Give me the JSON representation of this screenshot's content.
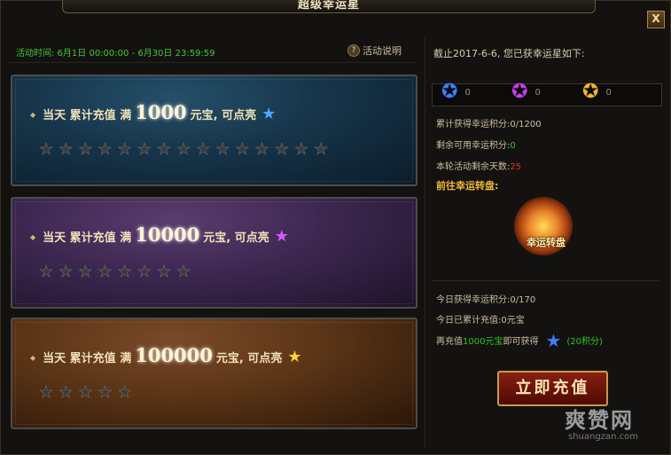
{
  "window": {
    "title": "超级幸运星",
    "close_label": "X"
  },
  "activity": {
    "time_label": "活动时间: 6月1日 00:00:00 - 6月30日 23:59:59",
    "help_icon": "?",
    "help_label": "活动说明"
  },
  "tiers": [
    {
      "diamond": "◆",
      "prefix": "当天 累计充值 满",
      "amount": "1000",
      "suffix": "元宝, 可点亮",
      "star_color": "#4aa8ff",
      "star_total": 15,
      "star_lit": 0
    },
    {
      "diamond": "◆",
      "prefix": "当天 累计充值 满",
      "amount": "10000",
      "suffix": "元宝, 可点亮",
      "star_color": "#d65cff",
      "star_total": 8,
      "star_lit": 0
    },
    {
      "diamond": "◆",
      "prefix": "当天 累计充值 满",
      "amount": "100000",
      "suffix": "元宝, 可点亮",
      "star_color": "#ffd23a",
      "star_total": 5,
      "star_lit": 0
    }
  ],
  "summary": {
    "deadline_text": "截止2017-6-6, 您已获幸运星如下:",
    "counts": [
      {
        "icon": "blue-star-icon",
        "color": "#3b7fff",
        "value": "0"
      },
      {
        "icon": "purple-star-icon",
        "color": "#c43fe8",
        "value": "0"
      },
      {
        "icon": "gold-star-icon",
        "color": "#f0b52a",
        "value": "0"
      }
    ],
    "total_points_label": "累计获得幸运积分:",
    "total_points": "0/1200",
    "remaining_points_label": "剩余可用幸运积分:",
    "remaining_points": "0",
    "days_left_label": "本轮活动剩余天数:",
    "days_left": "25",
    "goto_label": "前往幸运转盘:",
    "wheel_label": "幸运转盘",
    "today_points_label": "今日获得幸运积分:",
    "today_points": "0/170",
    "today_recharge_label": "今日已累计充值:",
    "today_recharge": "0元宝",
    "next_prefix": "再充值",
    "next_amount": "1000元宝",
    "next_suffix": "即可获得",
    "next_points": "(20积分)",
    "recharge_button": "立即充值"
  },
  "watermark": {
    "main": "爽赞网",
    "sub": "shuangzan.com"
  }
}
